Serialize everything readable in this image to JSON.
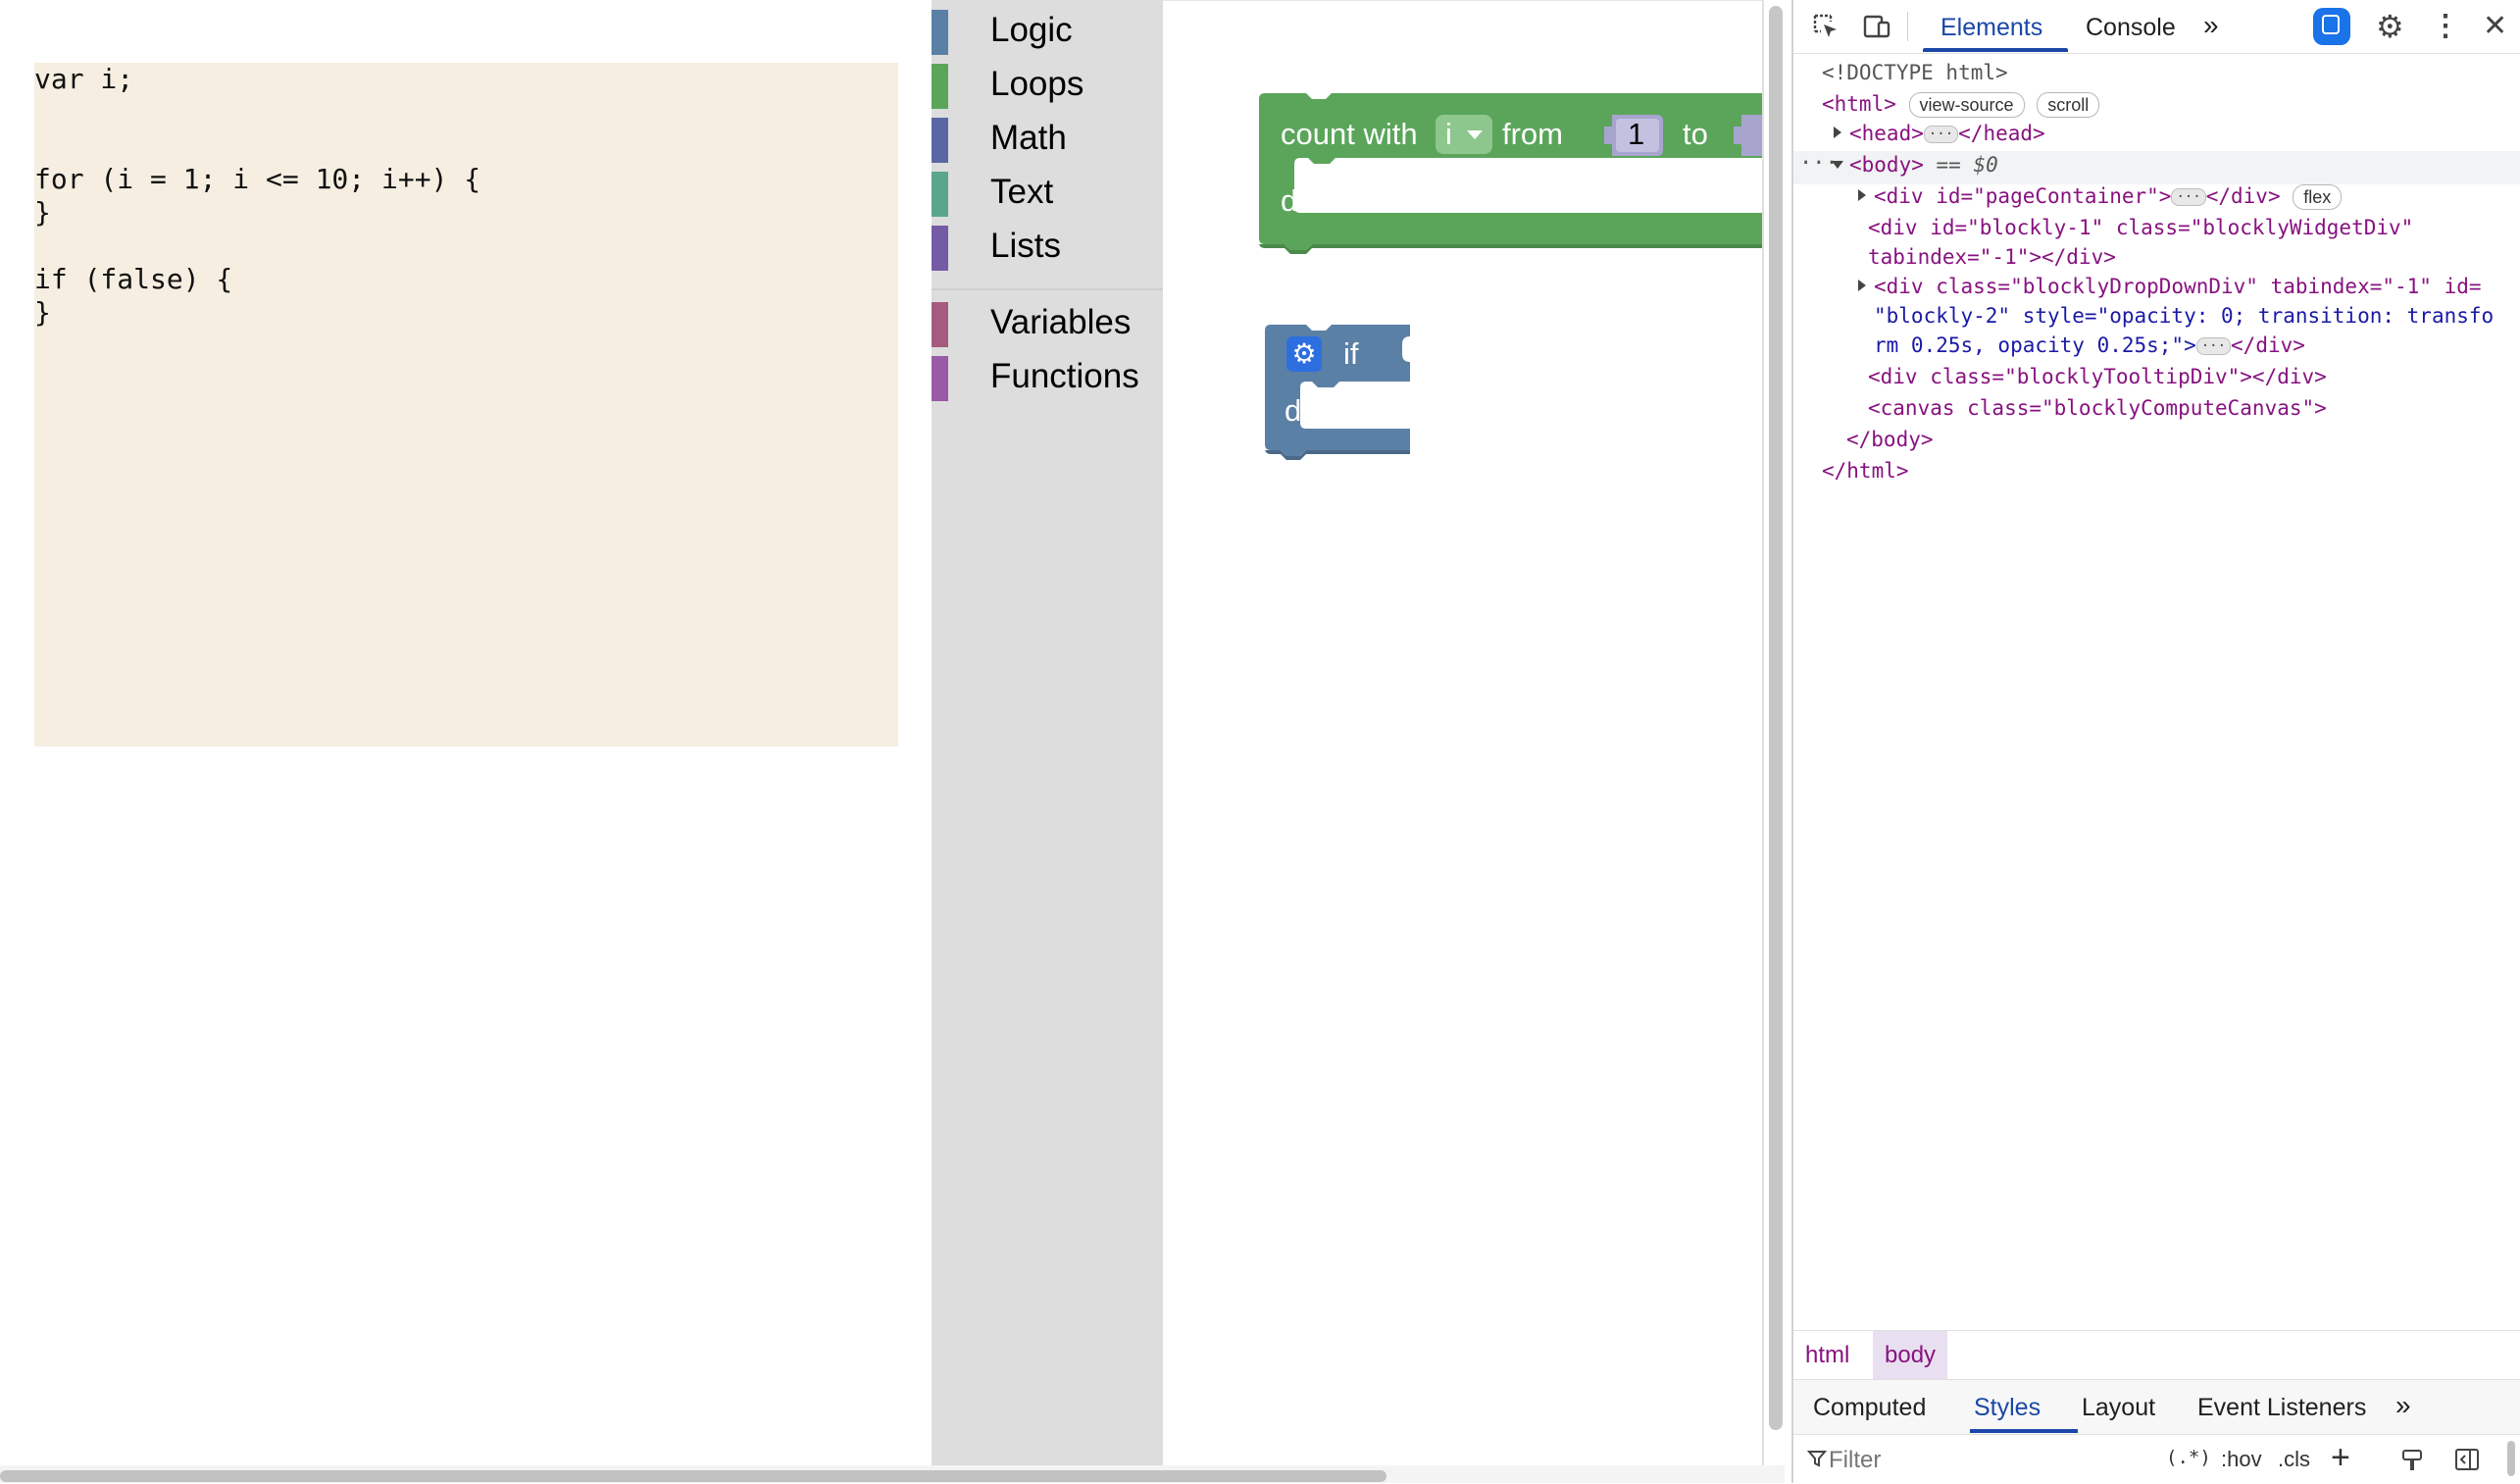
{
  "code_panel": {
    "lines": [
      "var i;",
      "",
      "",
      "for (i = 1; i <= 10; i++) {",
      "}",
      "",
      "if (false) {",
      "}"
    ]
  },
  "toolbox": {
    "categories": [
      {
        "label": "Logic",
        "color": "#5b80a5"
      },
      {
        "label": "Loops",
        "color": "#5ba55b"
      },
      {
        "label": "Math",
        "color": "#5b67a5"
      },
      {
        "label": "Text",
        "color": "#5ba58c"
      },
      {
        "label": "Lists",
        "color": "#745ba5"
      },
      {
        "label": "Variables",
        "color": "#a55b80"
      },
      {
        "label": "Functions",
        "color": "#995ba5"
      }
    ]
  },
  "workspace": {
    "loop_block": {
      "color": "#5ba55b",
      "count_with": "count with",
      "variable": "i",
      "from": "from",
      "from_value": "1",
      "to": "to",
      "do": "do"
    },
    "if_block": {
      "color": "#5b80a5",
      "if": "if",
      "do": "do"
    }
  },
  "devtools": {
    "tabs": {
      "elements": "Elements",
      "console": "Console"
    },
    "dom": {
      "doctype": "<!DOCTYPE html>",
      "html_open": "<html>",
      "pill_view_source": "view-source",
      "pill_scroll": "scroll",
      "head": "<head>",
      "head_close": "</head>",
      "body_open": "<body>",
      "body_marker": "== $0",
      "page_container": "<div id=\"pageContainer\">",
      "div_close": "</div>",
      "pill_flex": "flex",
      "widget_div_1": "<div id=\"blockly-1\" class=\"blocklyWidgetDiv\"",
      "widget_div_2": "tabindex=\"-1\"></div>",
      "dropdown_1": "<div class=\"blocklyDropDownDiv\" tabindex=\"-1\" id=",
      "dropdown_2": "\"blockly-2\" style=\"opacity: 0; transition: transfo",
      "dropdown_3": "rm 0.25s, opacity 0.25s;\">",
      "tooltip_div": "<div class=\"blocklyTooltipDiv\"></div>",
      "canvas": "<canvas class=\"blocklyComputeCanvas\">",
      "body_close": "</body>",
      "html_close": "</html>"
    },
    "breadcrumbs": [
      "html",
      "body"
    ],
    "styles_tabs": {
      "computed": "Computed",
      "styles": "Styles",
      "layout": "Layout",
      "event_listeners": "Event Listeners"
    },
    "filter": {
      "placeholder": "Filter",
      "regex": "(.*)",
      "hov": ":hov",
      "cls": ".cls"
    }
  }
}
